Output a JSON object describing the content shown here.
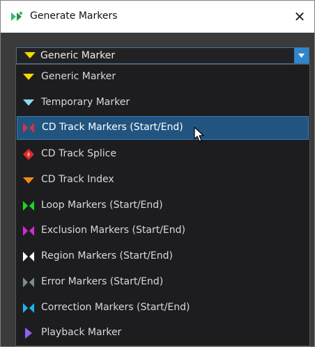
{
  "window": {
    "title": "Generate Markers",
    "close_glyph": "✕"
  },
  "combo": {
    "selected_label": "Generic Marker",
    "selected_icon": "generic-marker-icon",
    "dropdown_arrow": "chevron-down-icon"
  },
  "dropdown": {
    "items": [
      {
        "label": "Generic Marker",
        "icon": "generic-marker-icon",
        "color": "#f5d800"
      },
      {
        "label": "Temporary Marker",
        "icon": "temporary-marker-icon",
        "color": "#8fd7f5"
      },
      {
        "label": "CD Track Markers (Start/End)",
        "icon": "cd-track-markers-icon",
        "color": "#d5334a",
        "selected": true
      },
      {
        "label": "CD Track Splice",
        "icon": "cd-track-splice-icon",
        "color": "#e02a2a"
      },
      {
        "label": "CD Track Index",
        "icon": "cd-track-index-icon",
        "color": "#f08a16"
      },
      {
        "label": "Loop Markers (Start/End)",
        "icon": "loop-markers-icon",
        "color": "#1cd62a"
      },
      {
        "label": "Exclusion Markers (Start/End)",
        "icon": "exclusion-markers-icon",
        "color": "#d52ad5"
      },
      {
        "label": "Region Markers (Start/End)",
        "icon": "region-markers-icon",
        "color": "#ffffff"
      },
      {
        "label": "Error Markers (Start/End)",
        "icon": "error-markers-icon",
        "color": "#7a8f90"
      },
      {
        "label": "Correction Markers (Start/End)",
        "icon": "correction-markers-icon",
        "color": "#19b6ea"
      },
      {
        "label": "Playback Marker",
        "icon": "playback-marker-icon",
        "color": "#8a63f0"
      }
    ]
  }
}
